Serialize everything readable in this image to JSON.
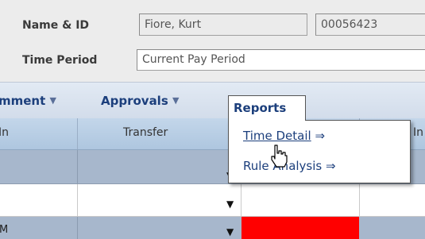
{
  "header": {
    "name_label": "Name & ID",
    "name_value": "Fiore, Kurt",
    "id_value": "00056423",
    "period_label": "Time Period",
    "period_value": "Current Pay Period"
  },
  "menubar": {
    "items": [
      {
        "label": "mment",
        "arrow": "▼"
      },
      {
        "label": "Approvals",
        "arrow": "▼"
      }
    ],
    "active": "Reports"
  },
  "dropdown": {
    "items": [
      {
        "label": "Time Detail",
        "arrow": "⇒"
      },
      {
        "label": "Rule Analysis",
        "arrow": "⇒"
      }
    ]
  },
  "grid": {
    "columns": [
      "In",
      "Transfer",
      "In"
    ],
    "row3_text": "M",
    "dropdown_glyph": "▼",
    "highlight_color": "#ff0000"
  },
  "colors": {
    "menu_text": "#1c3f7c",
    "header_bg": "#ececec",
    "grid_header_bg": "#aec6df",
    "row_shaded_bg": "#a7b7cc"
  }
}
